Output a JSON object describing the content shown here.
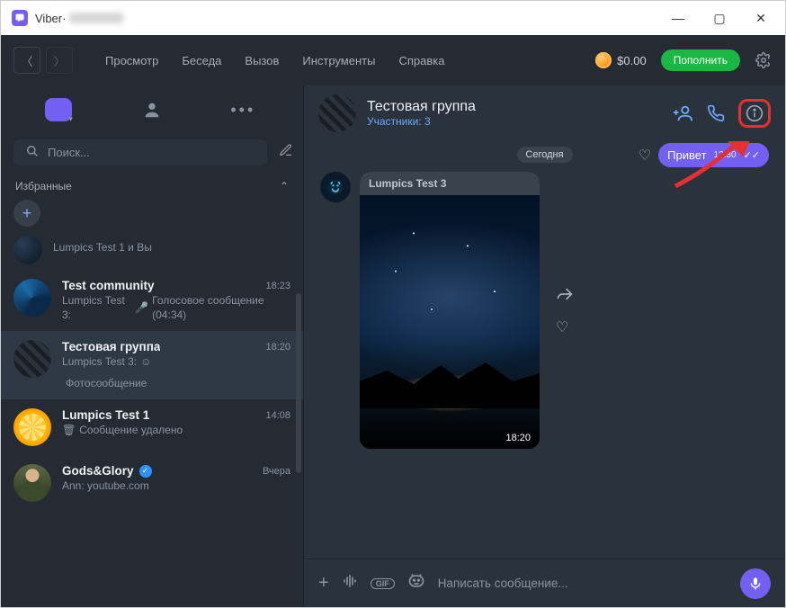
{
  "window": {
    "app": "Viber",
    "sep": " · "
  },
  "menu": {
    "items": [
      "Просмотр",
      "Беседа",
      "Вызов",
      "Инструменты",
      "Справка"
    ],
    "balance": "$0.00",
    "topup": "Пополнить"
  },
  "sidebar": {
    "search_placeholder": "Поиск...",
    "favorites_label": "Избранные",
    "chats": [
      {
        "name": "Lumpics Test 1 и Вы",
        "time": "",
        "preview": ""
      },
      {
        "name": "Test community",
        "time": "18:23",
        "preview_prefix": "Lumpics Test 3:",
        "preview_voice": "Голосовое сообщение (04:34)"
      },
      {
        "name": "Тестовая группа",
        "time": "18:20",
        "preview_prefix": "Lumpics Test 3:",
        "preview_photo": "Фотосообщение"
      },
      {
        "name": "Lumpics Test 1",
        "time": "14:08",
        "preview_deleted": "Сообщение удалено"
      },
      {
        "name": "Gods&Glory",
        "time": "Вчера",
        "preview": "Ann: youtube.com",
        "verified": true
      }
    ]
  },
  "conversation": {
    "title": "Тестовая группа",
    "subtitle_label": "Участники:",
    "subtitle_count": "3",
    "date_chip": "Сегодня",
    "outgoing": {
      "text": "Привет",
      "time": "12:30"
    },
    "incoming": {
      "sender": "Lumpics Test 3",
      "time": "18:20"
    },
    "composer_placeholder": "Написать сообщение...",
    "gif_label": "GIF"
  }
}
